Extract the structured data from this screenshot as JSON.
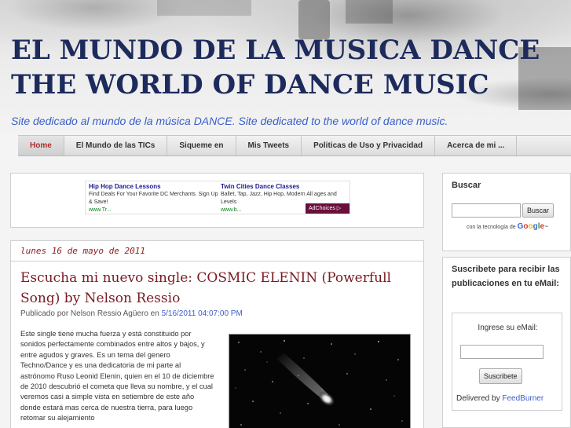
{
  "header": {
    "title_line1": "EL MUNDO DE LA MUSICA DANCE",
    "title_line2": "THE WORLD OF DANCE MUSIC",
    "tagline": "Site dedicado al mundo de la música DANCE. Site dedicated to the world of dance music."
  },
  "nav": {
    "items": [
      {
        "label": "Home"
      },
      {
        "label": "El Mundo de las TICs"
      },
      {
        "label": "Siqueme en"
      },
      {
        "label": "Mis Tweets"
      },
      {
        "label": "Politicas de Uso y Privacidad"
      },
      {
        "label": "Acerca de mi ..."
      }
    ]
  },
  "ad": {
    "left": {
      "title": "Hip Hop Dance Lessons",
      "text": "Find Deals For Your Favorite DC Merchants. Sign Up & Save!",
      "url": "www.Tr..."
    },
    "right": {
      "title": "Twin Cities Dance Classes",
      "text": "Ballet, Tap, Jazz, Hip Hop, Modern All ages and Levels",
      "url": "www.b..."
    },
    "choices_label": "AdChoices ▷"
  },
  "post": {
    "date": "lunes 16 de mayo de 2011",
    "title": "Escucha mi nuevo single: COSMIC ELENIN (Powerfull Song) by Nelson Ressio",
    "byline_prefix": "Publicado por Nelson Ressio Agüero en",
    "byline_time": "5/16/2011 04:07:00 PM",
    "body": "Este single tiene mucha fuerza y está constituido por sonidos perfectamente combinados entre altos y bajos, y entre agudos y graves. Es un tema del genero Techno/Dance y es una dedicatoria de mi parte al astrónomo Ruso Leonid Elenin, quien en el 10 de diciembre de 2010 descubrió el cometa que lleva su nombre, y el cual veremos casi a simple vista en setiembre de este año donde estará mas cerca de nuestra tierra, para luego retomar su alejamiento"
  },
  "sidebar": {
    "search": {
      "title": "Buscar",
      "button": "Buscar",
      "powered_text": "con la tecnología de",
      "google": "Google™"
    },
    "subscribe": {
      "title": "Suscribete para recibir las publicaciones en tu eMail:",
      "label": "Ingrese su eMail:",
      "button": "Suscribete",
      "delivered_prefix": "Delivered by",
      "delivered_link": "FeedBurner"
    }
  },
  "colors": {
    "title": "#1d2a5c",
    "tagline": "#3a5ec8",
    "post_title": "#7a1a22",
    "link": "#3a5ec8"
  }
}
